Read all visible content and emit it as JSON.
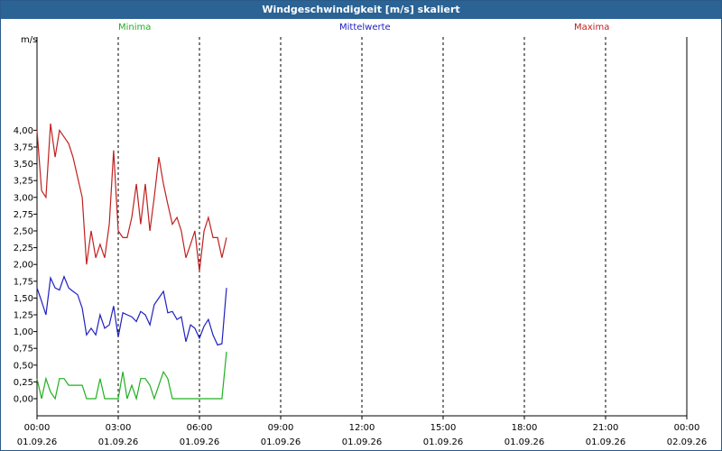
{
  "window": {
    "title": "Windgeschwindigkeit [m/s] skaliert"
  },
  "legend": [
    {
      "label": "Minima",
      "color": "#20b020"
    },
    {
      "label": "Mittelwerte",
      "color": "#2020c0"
    },
    {
      "label": "Maxima",
      "color": "#c02020"
    }
  ],
  "chart_data": {
    "type": "line",
    "title": "Windgeschwindigkeit [m/s] skaliert",
    "ylabel": "m/s",
    "ylim": [
      0,
      4.25
    ],
    "xlim_hours": [
      0,
      24
    ],
    "grid": "dashed",
    "yticks": [
      "0,00",
      "0,25",
      "0,50",
      "0,75",
      "1,00",
      "1,25",
      "1,50",
      "1,75",
      "2,00",
      "2,25",
      "2,50",
      "2,75",
      "3,00",
      "3,25",
      "3,50",
      "3,75",
      "4,00"
    ],
    "xticks": [
      {
        "time": "00:00",
        "date": "01.09.26"
      },
      {
        "time": "03:00",
        "date": "01.09.26"
      },
      {
        "time": "06:00",
        "date": "01.09.26"
      },
      {
        "time": "09:00",
        "date": "01.09.26"
      },
      {
        "time": "12:00",
        "date": "01.09.26"
      },
      {
        "time": "15:00",
        "date": "01.09.26"
      },
      {
        "time": "18:00",
        "date": "01.09.26"
      },
      {
        "time": "21:00",
        "date": "01.09.26"
      },
      {
        "time": "00:00",
        "date": "02.09.26"
      }
    ],
    "series": [
      {
        "name": "Maxima",
        "color": "#c02020",
        "points": [
          [
            0.0,
            4.0
          ],
          [
            0.17,
            3.1
          ],
          [
            0.33,
            3.0
          ],
          [
            0.5,
            4.1
          ],
          [
            0.67,
            3.6
          ],
          [
            0.83,
            4.0
          ],
          [
            1.0,
            3.9
          ],
          [
            1.17,
            3.8
          ],
          [
            1.33,
            3.6
          ],
          [
            1.5,
            3.3
          ],
          [
            1.67,
            3.0
          ],
          [
            1.83,
            2.0
          ],
          [
            2.0,
            2.5
          ],
          [
            2.17,
            2.1
          ],
          [
            2.33,
            2.3
          ],
          [
            2.5,
            2.1
          ],
          [
            2.67,
            2.6
          ],
          [
            2.83,
            3.7
          ],
          [
            3.0,
            2.5
          ],
          [
            3.17,
            2.4
          ],
          [
            3.33,
            2.4
          ],
          [
            3.5,
            2.7
          ],
          [
            3.67,
            3.2
          ],
          [
            3.83,
            2.6
          ],
          [
            4.0,
            3.2
          ],
          [
            4.17,
            2.5
          ],
          [
            4.33,
            3.0
          ],
          [
            4.5,
            3.6
          ],
          [
            4.67,
            3.2
          ],
          [
            4.83,
            2.9
          ],
          [
            5.0,
            2.6
          ],
          [
            5.17,
            2.7
          ],
          [
            5.33,
            2.5
          ],
          [
            5.5,
            2.1
          ],
          [
            5.67,
            2.3
          ],
          [
            5.83,
            2.5
          ],
          [
            6.0,
            1.9
          ],
          [
            6.17,
            2.5
          ],
          [
            6.33,
            2.7
          ],
          [
            6.5,
            2.4
          ],
          [
            6.67,
            2.4
          ],
          [
            6.83,
            2.1
          ],
          [
            7.0,
            2.4
          ]
        ]
      },
      {
        "name": "Mittelwerte",
        "color": "#2020c0",
        "points": [
          [
            0.0,
            1.65
          ],
          [
            0.17,
            1.45
          ],
          [
            0.33,
            1.25
          ],
          [
            0.5,
            1.8
          ],
          [
            0.67,
            1.65
          ],
          [
            0.83,
            1.62
          ],
          [
            1.0,
            1.82
          ],
          [
            1.17,
            1.65
          ],
          [
            1.33,
            1.6
          ],
          [
            1.5,
            1.55
          ],
          [
            1.67,
            1.35
          ],
          [
            1.83,
            0.95
          ],
          [
            2.0,
            1.05
          ],
          [
            2.17,
            0.95
          ],
          [
            2.33,
            1.25
          ],
          [
            2.5,
            1.05
          ],
          [
            2.67,
            1.1
          ],
          [
            2.83,
            1.38
          ],
          [
            3.0,
            0.92
          ],
          [
            3.17,
            1.28
          ],
          [
            3.33,
            1.25
          ],
          [
            3.5,
            1.22
          ],
          [
            3.67,
            1.15
          ],
          [
            3.83,
            1.3
          ],
          [
            4.0,
            1.25
          ],
          [
            4.17,
            1.1
          ],
          [
            4.33,
            1.4
          ],
          [
            4.5,
            1.5
          ],
          [
            4.67,
            1.6
          ],
          [
            4.83,
            1.28
          ],
          [
            5.0,
            1.3
          ],
          [
            5.17,
            1.18
          ],
          [
            5.33,
            1.22
          ],
          [
            5.5,
            0.85
          ],
          [
            5.67,
            1.1
          ],
          [
            5.83,
            1.05
          ],
          [
            6.0,
            0.9
          ],
          [
            6.17,
            1.08
          ],
          [
            6.33,
            1.18
          ],
          [
            6.5,
            0.95
          ],
          [
            6.67,
            0.8
          ],
          [
            6.83,
            0.82
          ],
          [
            7.0,
            1.65
          ]
        ]
      },
      {
        "name": "Minima",
        "color": "#20b020",
        "points": [
          [
            0.0,
            0.3
          ],
          [
            0.17,
            0.0
          ],
          [
            0.33,
            0.3
          ],
          [
            0.5,
            0.1
          ],
          [
            0.67,
            0.0
          ],
          [
            0.83,
            0.3
          ],
          [
            1.0,
            0.3
          ],
          [
            1.17,
            0.2
          ],
          [
            1.33,
            0.2
          ],
          [
            1.5,
            0.2
          ],
          [
            1.67,
            0.2
          ],
          [
            1.83,
            0.0
          ],
          [
            2.0,
            0.0
          ],
          [
            2.17,
            0.0
          ],
          [
            2.33,
            0.3
          ],
          [
            2.5,
            0.0
          ],
          [
            2.67,
            0.0
          ],
          [
            2.83,
            0.0
          ],
          [
            3.0,
            0.0
          ],
          [
            3.17,
            0.4
          ],
          [
            3.33,
            0.0
          ],
          [
            3.5,
            0.2
          ],
          [
            3.67,
            0.0
          ],
          [
            3.83,
            0.3
          ],
          [
            4.0,
            0.3
          ],
          [
            4.17,
            0.2
          ],
          [
            4.33,
            0.0
          ],
          [
            4.5,
            0.2
          ],
          [
            4.67,
            0.4
          ],
          [
            4.83,
            0.3
          ],
          [
            5.0,
            0.0
          ],
          [
            5.17,
            0.0
          ],
          [
            5.33,
            0.0
          ],
          [
            5.5,
            0.0
          ],
          [
            5.67,
            0.0
          ],
          [
            5.83,
            0.0
          ],
          [
            6.0,
            0.0
          ],
          [
            6.17,
            0.0
          ],
          [
            6.33,
            0.0
          ],
          [
            6.5,
            0.0
          ],
          [
            6.67,
            0.0
          ],
          [
            6.83,
            0.0
          ],
          [
            7.0,
            0.7
          ]
        ]
      }
    ]
  }
}
